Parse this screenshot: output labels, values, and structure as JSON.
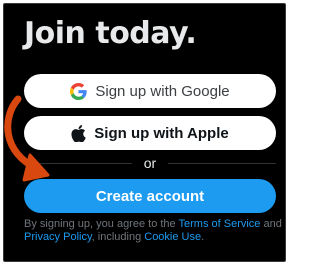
{
  "signup": {
    "title": "Join today.",
    "google_button": "Sign up with Google",
    "apple_button": "Sign up with Apple",
    "divider_text": "or",
    "create_button": "Create account",
    "legal": {
      "prefix": "By signing up, you agree to the ",
      "terms_link": "Terms of Service",
      "and": " and ",
      "privacy_link": "Privacy Policy",
      "middle": ", including ",
      "cookie_link": "Cookie Use",
      "suffix": "."
    }
  },
  "colors": {
    "panel_background": "#000000",
    "primary_blue": "#1d9bf0",
    "annotation_arrow": "#d9480f"
  },
  "icons": {
    "google": "google-g-logo",
    "apple": "apple-logo",
    "arrow": "curved-arrow-annotation"
  }
}
